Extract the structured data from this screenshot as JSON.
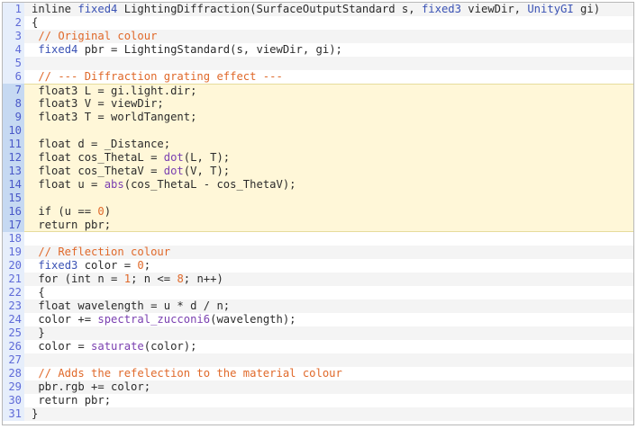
{
  "colors": {
    "comment": "#e0692a",
    "type": "#3a52b4",
    "number": "#e0692a",
    "function": "#7a3fb0",
    "plain": "#2b2b2b",
    "highlight_bg": "#fff7d8",
    "gutter_bg": "#e6eefb"
  },
  "code_lines": [
    {
      "num": "1",
      "tokens": [
        [
          "p",
          "inline "
        ],
        [
          "t",
          "fixed4"
        ],
        [
          "p",
          " LightingDiffraction(SurfaceOutputStandard s, "
        ],
        [
          "t",
          "fixed3"
        ],
        [
          "p",
          " viewDir, "
        ],
        [
          "t",
          "UnityGI"
        ],
        [
          "p",
          " gi)"
        ]
      ]
    },
    {
      "num": "2",
      "tokens": [
        [
          "p",
          "{"
        ]
      ]
    },
    {
      "num": "3",
      "tokens": [
        [
          "c",
          " // Original colour"
        ]
      ]
    },
    {
      "num": "4",
      "tokens": [
        [
          "p",
          " "
        ],
        [
          "t",
          "fixed4"
        ],
        [
          "p",
          " pbr = LightingStandard(s, viewDir, gi);"
        ]
      ]
    },
    {
      "num": "5",
      "tokens": [
        [
          "p",
          ""
        ]
      ]
    },
    {
      "num": "6",
      "tokens": [
        [
          "c",
          " // --- Diffraction grating effect ---"
        ]
      ]
    },
    {
      "num": "7",
      "hl": true,
      "tokens": [
        [
          "p",
          " float3 L = gi.light.dir;"
        ]
      ]
    },
    {
      "num": "8",
      "hl": true,
      "tokens": [
        [
          "p",
          " float3 V = viewDir;"
        ]
      ]
    },
    {
      "num": "9",
      "hl": true,
      "tokens": [
        [
          "p",
          " float3 T = worldTangent;"
        ]
      ]
    },
    {
      "num": "10",
      "hl": true,
      "tokens": [
        [
          "p",
          ""
        ]
      ]
    },
    {
      "num": "11",
      "hl": true,
      "tokens": [
        [
          "p",
          " float d = _Distance;"
        ]
      ]
    },
    {
      "num": "12",
      "hl": true,
      "tokens": [
        [
          "p",
          " float cos_ThetaL = "
        ],
        [
          "f",
          "dot"
        ],
        [
          "p",
          "(L, T);"
        ]
      ]
    },
    {
      "num": "13",
      "hl": true,
      "tokens": [
        [
          "p",
          " float cos_ThetaV = "
        ],
        [
          "f",
          "dot"
        ],
        [
          "p",
          "(V, T);"
        ]
      ]
    },
    {
      "num": "14",
      "hl": true,
      "tokens": [
        [
          "p",
          " float u = "
        ],
        [
          "f",
          "abs"
        ],
        [
          "p",
          "(cos_ThetaL - cos_ThetaV);"
        ]
      ]
    },
    {
      "num": "15",
      "hl": true,
      "tokens": [
        [
          "p",
          ""
        ]
      ]
    },
    {
      "num": "16",
      "hl": true,
      "tokens": [
        [
          "p",
          " if (u == "
        ],
        [
          "n",
          "0"
        ],
        [
          "p",
          ")"
        ]
      ]
    },
    {
      "num": "17",
      "hl": true,
      "tokens": [
        [
          "p",
          " return pbr;"
        ]
      ]
    },
    {
      "num": "18",
      "tokens": [
        [
          "p",
          ""
        ]
      ]
    },
    {
      "num": "19",
      "tokens": [
        [
          "c",
          " // Reflection colour"
        ]
      ]
    },
    {
      "num": "20",
      "tokens": [
        [
          "p",
          " "
        ],
        [
          "t",
          "fixed3"
        ],
        [
          "p",
          " color = "
        ],
        [
          "n",
          "0"
        ],
        [
          "p",
          ";"
        ]
      ]
    },
    {
      "num": "21",
      "tokens": [
        [
          "p",
          " for (int n = "
        ],
        [
          "n",
          "1"
        ],
        [
          "p",
          "; n <= "
        ],
        [
          "n",
          "8"
        ],
        [
          "p",
          "; n++)"
        ]
      ]
    },
    {
      "num": "22",
      "tokens": [
        [
          "p",
          " {"
        ]
      ]
    },
    {
      "num": "23",
      "tokens": [
        [
          "p",
          " float wavelength = u * d / n;"
        ]
      ]
    },
    {
      "num": "24",
      "tokens": [
        [
          "p",
          " color += "
        ],
        [
          "f",
          "spectral_zucconi6"
        ],
        [
          "p",
          "(wavelength);"
        ]
      ]
    },
    {
      "num": "25",
      "tokens": [
        [
          "p",
          " }"
        ]
      ]
    },
    {
      "num": "26",
      "tokens": [
        [
          "p",
          " color = "
        ],
        [
          "f",
          "saturate"
        ],
        [
          "p",
          "(color);"
        ]
      ]
    },
    {
      "num": "27",
      "tokens": [
        [
          "p",
          ""
        ]
      ]
    },
    {
      "num": "28",
      "tokens": [
        [
          "c",
          " // Adds the refelection to the material colour"
        ]
      ]
    },
    {
      "num": "29",
      "tokens": [
        [
          "p",
          " pbr.rgb += color;"
        ]
      ]
    },
    {
      "num": "30",
      "tokens": [
        [
          "p",
          " return pbr;"
        ]
      ]
    },
    {
      "num": "31",
      "tokens": [
        [
          "p",
          "}"
        ]
      ]
    }
  ]
}
